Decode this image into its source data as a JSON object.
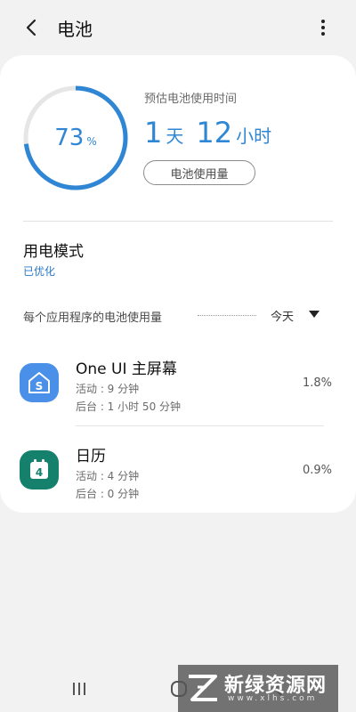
{
  "header": {
    "title": "电池"
  },
  "battery": {
    "level_percent": 73,
    "level_text": "73",
    "level_unit": "%",
    "estimate_label": "预估电池使用时间",
    "estimate_days": "1",
    "estimate_days_unit": "天",
    "estimate_hours": "12",
    "estimate_hours_unit": "小时",
    "usage_button_label": "电池使用量"
  },
  "power_mode": {
    "title": "用电模式",
    "value": "已优化"
  },
  "app_usage": {
    "section_label": "每个应用程序的电池使用量",
    "period": "今天",
    "apps": [
      {
        "name": "One UI 主屏幕",
        "active": "活动 : 9 分钟",
        "background": "后台 : 1 小时 50 分钟",
        "percent": "1.8%",
        "icon": "home-screen-icon"
      },
      {
        "name": "日历",
        "active": "活动 : 4 分钟",
        "background": "后台 : 0 分钟",
        "percent": "0.9%",
        "icon": "calendar-icon",
        "icon_text": "4"
      }
    ]
  },
  "watermark": {
    "title": "新绿资源网",
    "url": "www.xlhs.com"
  },
  "colors": {
    "accent": "#2f86d4",
    "ring_track": "#e6e6e6",
    "home_icon_bg": "#4a8fe8",
    "calendar_icon_bg": "#15806b"
  }
}
